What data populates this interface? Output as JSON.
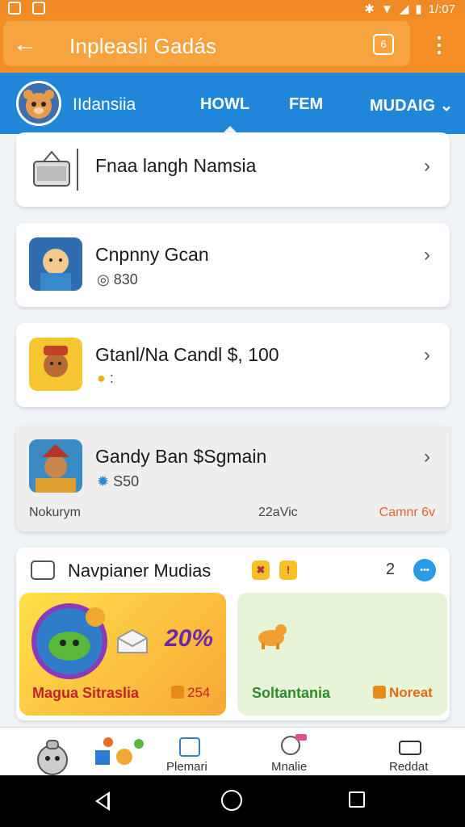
{
  "status_bar": {
    "time": "1/:07"
  },
  "app_bar": {
    "title": "Inpleasli Gadás",
    "badge": "6"
  },
  "tab_bar": {
    "brand": "IIdansiia",
    "tabs": [
      "HOWL",
      "FEM",
      "MUDAIG"
    ]
  },
  "cards": [
    {
      "title": "Fnaa langh Namsia"
    },
    {
      "title": "Cnpnny Gcan",
      "sub": "830"
    },
    {
      "title": "Gtanl/Na Candl $, 100",
      "sub": ":"
    },
    {
      "title": "Gandy Ban $Sgmain",
      "sub": "S50",
      "footer_left": "Nokurym",
      "footer_mid": "22aVic",
      "footer_right": "Camnr 6v"
    }
  ],
  "section": {
    "title": "Navpianer Mudias",
    "count": "2",
    "promo_left": {
      "label": "Magua Sitraslia",
      "pct": "20%",
      "count": "254"
    },
    "promo_right": {
      "label": "Soltantania",
      "tag": "Noreat"
    }
  },
  "bottom_nav": {
    "items": [
      "Plemari",
      "Mnalie",
      "Reddat"
    ]
  }
}
